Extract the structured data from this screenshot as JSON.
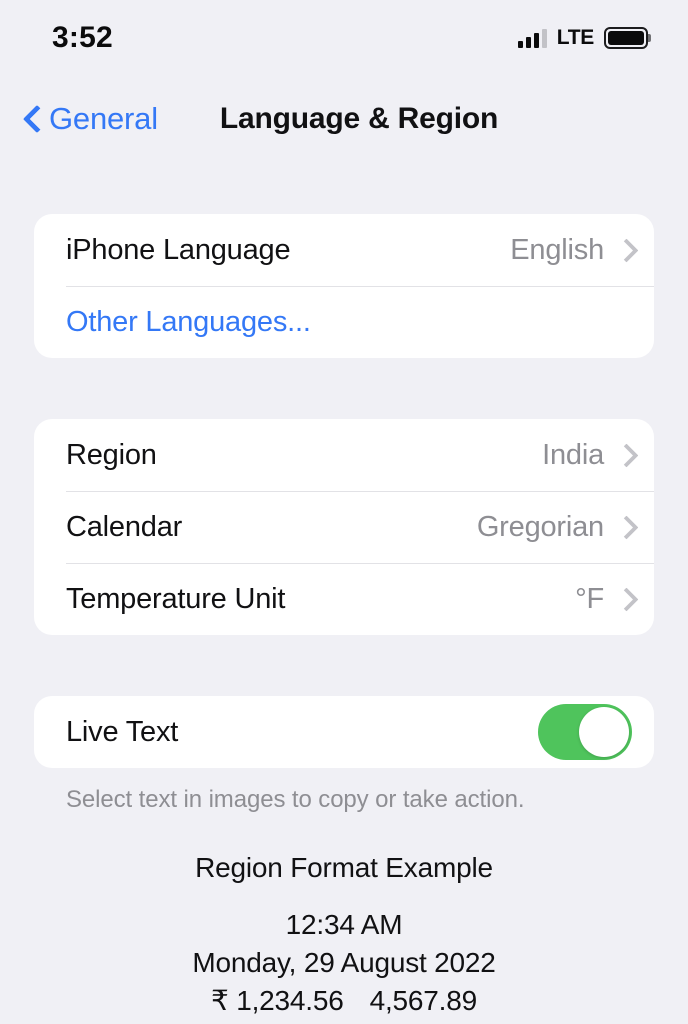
{
  "status_bar": {
    "time": "3:52",
    "network_label": "LTE",
    "signal_icon": "signal-bars-icon",
    "signal_bars_filled": 3,
    "signal_bars_total": 4,
    "battery_icon": "battery-full-icon",
    "battery_level_percent": 100
  },
  "nav": {
    "back_icon": "chevron-left-icon",
    "back_label": "General",
    "title": "Language & Region"
  },
  "colors": {
    "page_background": "#f0f0f5",
    "card_background": "#ffffff",
    "accent_blue": "#3478f6",
    "value_gray": "#8e8e93",
    "toggle_on_green": "#4fc45c",
    "separator": "#e2e2e6"
  },
  "groups": [
    {
      "name": "language-group",
      "rows": [
        {
          "name": "iphone-language",
          "label": "iPhone Language",
          "value": "English",
          "accessory": "chevron-right-icon",
          "style": "default"
        },
        {
          "name": "other-languages",
          "label": "Other Languages...",
          "value": "",
          "accessory": "none",
          "style": "link"
        }
      ]
    },
    {
      "name": "region-group",
      "rows": [
        {
          "name": "region",
          "label": "Region",
          "value": "India",
          "accessory": "chevron-right-icon",
          "style": "default"
        },
        {
          "name": "calendar",
          "label": "Calendar",
          "value": "Gregorian",
          "accessory": "chevron-right-icon",
          "style": "default"
        },
        {
          "name": "temperature-unit",
          "label": "Temperature Unit",
          "value": "°F",
          "accessory": "chevron-right-icon",
          "style": "default"
        }
      ]
    }
  ],
  "live_text": {
    "label": "Live Text",
    "toggle_state": "on",
    "footnote": "Select text in images to copy or take action."
  },
  "region_format_example": {
    "title": "Region Format Example",
    "time": "12:34 AM",
    "date": "Monday, 29 August 2022",
    "currency": "₹ 1,234.56",
    "number": "4,567.89"
  }
}
